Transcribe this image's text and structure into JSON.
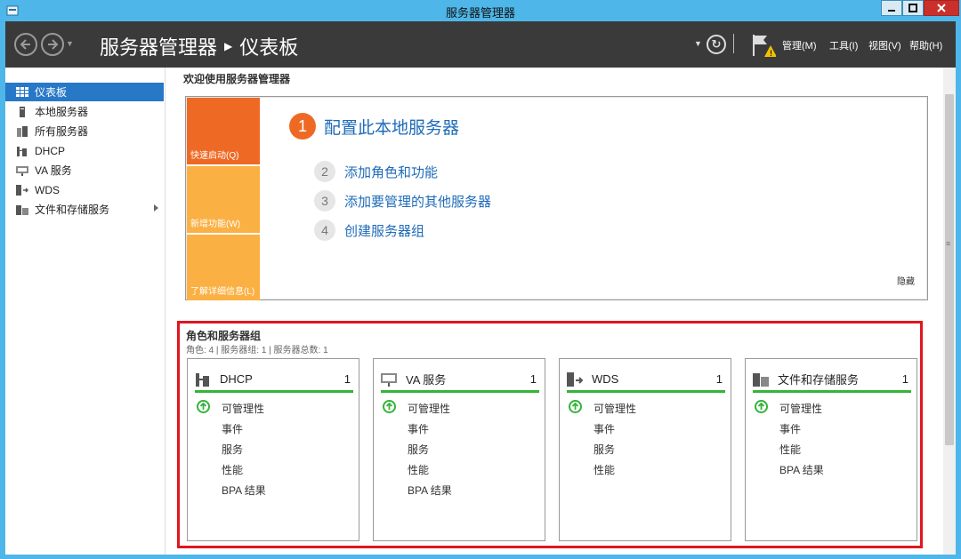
{
  "window": {
    "title": "服务器管理器"
  },
  "header": {
    "breadcrumb": [
      "服务器管理器",
      "仪表板"
    ],
    "menus": [
      "管理(M)",
      "工具(I)",
      "视图(V)",
      "帮助(H)"
    ]
  },
  "sidebar": {
    "items": [
      {
        "label": "仪表板",
        "icon": "dashboard-icon",
        "active": true
      },
      {
        "label": "本地服务器",
        "icon": "local-server-icon"
      },
      {
        "label": "所有服务器",
        "icon": "all-servers-icon"
      },
      {
        "label": "DHCP",
        "icon": "dhcp-icon"
      },
      {
        "label": "VA 服务",
        "icon": "va-service-icon"
      },
      {
        "label": "WDS",
        "icon": "wds-icon"
      },
      {
        "label": "文件和存储服务",
        "icon": "file-storage-icon",
        "has_submenu": true
      }
    ]
  },
  "welcome": {
    "title": "欢迎使用服务器管理器",
    "tiles": [
      "快速启动(Q)",
      "新增功能(W)",
      "了解详细信息(L)"
    ],
    "steps": [
      {
        "num": "1",
        "label": "配置此本地服务器"
      },
      {
        "num": "2",
        "label": "添加角色和功能"
      },
      {
        "num": "3",
        "label": "添加要管理的其他服务器"
      },
      {
        "num": "4",
        "label": "创建服务器组"
      }
    ],
    "hide_label": "隐藏"
  },
  "roles": {
    "title": "角色和服务器组",
    "subtitle": "角色: 4 | 服务器组: 1 | 服务器总数: 1",
    "cards": [
      {
        "name": "DHCP",
        "count": "1",
        "icon": "dhcp-icon",
        "rows": [
          "可管理性",
          "事件",
          "服务",
          "性能",
          "BPA 结果"
        ]
      },
      {
        "name": "VA 服务",
        "count": "1",
        "icon": "va-service-icon",
        "rows": [
          "可管理性",
          "事件",
          "服务",
          "性能",
          "BPA 结果"
        ]
      },
      {
        "name": "WDS",
        "count": "1",
        "icon": "wds-icon",
        "rows": [
          "可管理性",
          "事件",
          "服务",
          "性能"
        ]
      },
      {
        "name": "文件和存储服务",
        "count": "1",
        "icon": "file-storage-icon",
        "rows": [
          "可管理性",
          "事件",
          "性能",
          "BPA 结果"
        ]
      }
    ]
  },
  "colors": {
    "frame": "#4eb6e8",
    "header": "#3a3a3a",
    "accent_orange": "#ee6a24",
    "tile_yellow": "#fbb043",
    "link_blue": "#1e6bb8",
    "status_green": "#35b33a",
    "highlight_red": "#e0161e",
    "selection_blue": "#2878c8"
  }
}
